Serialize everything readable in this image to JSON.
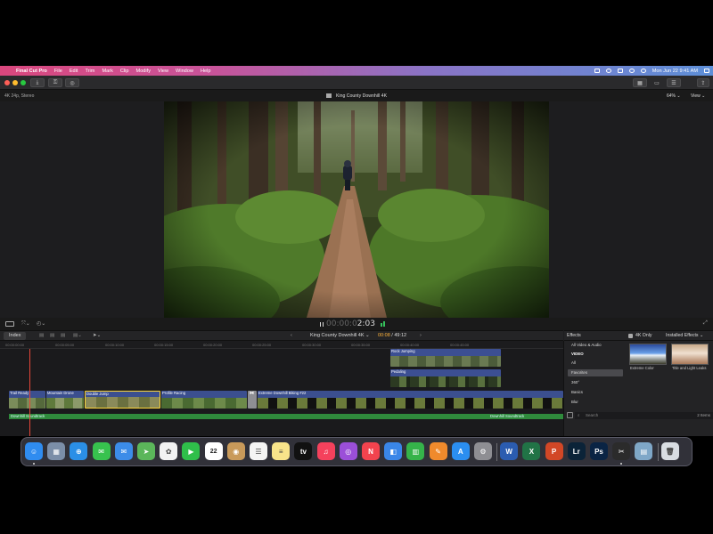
{
  "menubar": {
    "apple": "",
    "items": [
      "Final Cut Pro",
      "File",
      "Edit",
      "Trim",
      "Mark",
      "Clip",
      "Modify",
      "View",
      "Window",
      "Help"
    ],
    "clock": "Mon Jun 22  9:41 AM"
  },
  "viewer": {
    "format": "4K 24p, Stereo",
    "title": "King County Downhill 4K",
    "zoom": "64% ⌄",
    "view": "View ⌄",
    "timecode_dim": "00:00:0",
    "timecode": "2:03"
  },
  "timeline": {
    "index_label": "Index",
    "project": "King County Downhill 4K ⌄",
    "position": "00:08",
    "duration": " / 49:12",
    "ruler": [
      "00:00:00:00",
      "00:00:05:00",
      "00:00:10:00",
      "00:00:15:00",
      "00:00:20:00",
      "00:00:25:00",
      "00:00:30:00",
      "00:00:35:00",
      "00:00:40:00",
      "00:00:45:00"
    ],
    "connected_clips": [
      "Rock Jumping",
      "Pedaling"
    ],
    "primary_clips": [
      "Trail Ready",
      "Mountain Drone",
      "Double Jump",
      "Profile Racing",
      "Extreme Downhill Biking #22"
    ],
    "audio": [
      "Downhill Soundtrack",
      "Downhill Soundtrack"
    ]
  },
  "effects": {
    "title": "Effects",
    "filter": "4K Only",
    "installed": "Installed Effects ⌄",
    "categories": [
      "All Video & Audio",
      "VIDEO",
      "All",
      "Favorites",
      "360°",
      "Basics",
      "Blur"
    ],
    "thumbs": [
      "Extreme Color",
      "Title and Light Leaks"
    ],
    "search_placeholder": "Search",
    "count": "2 Items"
  },
  "dock": {
    "apps": [
      {
        "name": "Finder",
        "color": "#2f8cf0",
        "glyph": "☺"
      },
      {
        "name": "Launchpad",
        "color": "#7b8ea8",
        "glyph": "▦"
      },
      {
        "name": "Safari",
        "color": "#2b8fe6",
        "glyph": "⊕"
      },
      {
        "name": "Messages",
        "color": "#37c24e",
        "glyph": "✉"
      },
      {
        "name": "Mail",
        "color": "#3c8ce8",
        "glyph": "✉"
      },
      {
        "name": "Maps",
        "color": "#5bb65a",
        "glyph": "➤"
      },
      {
        "name": "Photos",
        "color": "#f2f2f2",
        "glyph": "✿"
      },
      {
        "name": "FaceTime",
        "color": "#2fbf4a",
        "glyph": "▶"
      },
      {
        "name": "Calendar",
        "color": "#ffffff",
        "glyph": "22"
      },
      {
        "name": "Contacts",
        "color": "#c99a5a",
        "glyph": "◉"
      },
      {
        "name": "Reminders",
        "color": "#f4f4f4",
        "glyph": "☰"
      },
      {
        "name": "Notes",
        "color": "#f8e48a",
        "glyph": "≡"
      },
      {
        "name": "Apple TV",
        "color": "#111111",
        "glyph": "tv"
      },
      {
        "name": "Music",
        "color": "#f5415c",
        "glyph": "♫"
      },
      {
        "name": "Podcasts",
        "color": "#9b4fd8",
        "glyph": "◎"
      },
      {
        "name": "News",
        "color": "#f2434e",
        "glyph": "N"
      },
      {
        "name": "Keynote",
        "color": "#3a86e8",
        "glyph": "◧"
      },
      {
        "name": "Numbers",
        "color": "#35b34a",
        "glyph": "▥"
      },
      {
        "name": "Pages",
        "color": "#f08a2c",
        "glyph": "✎"
      },
      {
        "name": "App Store",
        "color": "#2b8ef0",
        "glyph": "A"
      },
      {
        "name": "System Preferences",
        "color": "#8e8e93",
        "glyph": "⚙"
      },
      {
        "name": "Word",
        "color": "#2b5cb0",
        "glyph": "W"
      },
      {
        "name": "Excel",
        "color": "#217346",
        "glyph": "X"
      },
      {
        "name": "PowerPoint",
        "color": "#d24726",
        "glyph": "P"
      },
      {
        "name": "Lightroom",
        "color": "#0b2338",
        "glyph": "Lr"
      },
      {
        "name": "Photoshop",
        "color": "#0a2444",
        "glyph": "Ps"
      },
      {
        "name": "Final Cut Pro",
        "color": "#2b2b2b",
        "glyph": "✂"
      },
      {
        "name": "Preview",
        "color": "#7fa7c8",
        "glyph": "▤"
      },
      {
        "name": "Trash",
        "color": "#d9dde2",
        "glyph": "🗑"
      }
    ]
  },
  "colors": {
    "primary_clip": "#3b4f8f",
    "connected_clip": "#3c4f92",
    "audio": "#2f8a3c",
    "playhead": "#e8473a",
    "selected_clip_border": "#ffd83a"
  }
}
